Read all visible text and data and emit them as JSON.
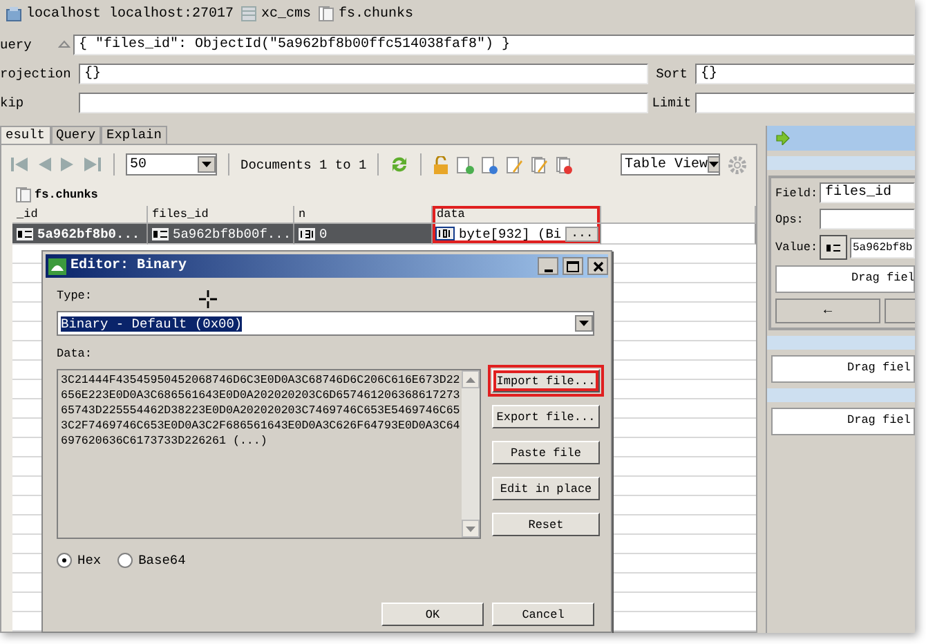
{
  "breadcrumb": [
    {
      "kind": "server",
      "label": "localhost localhost:27017"
    },
    {
      "kind": "database",
      "label": "xc_cms"
    },
    {
      "kind": "collection",
      "label": "fs.chunks"
    }
  ],
  "query": {
    "label": "uery",
    "value": "{ \"files_id\": ObjectId(\"5a962bf8b00ffc514038faf8\") }"
  },
  "projection": {
    "label": "rojection",
    "value": "{}"
  },
  "sort": {
    "label": "Sort",
    "value": "{}"
  },
  "skip": {
    "label": "kip"
  },
  "limit": {
    "label": "Limit"
  },
  "tabs": [
    {
      "label": "esult",
      "selected": true
    },
    {
      "label": "Query",
      "selected": false
    },
    {
      "label": "Explain",
      "selected": false
    }
  ],
  "toolbar": {
    "page_size": "50",
    "documents": "Documents 1 to 1",
    "view": "Table View"
  },
  "collection_title": "fs.chunks",
  "table": {
    "columns": [
      {
        "label": "_id",
        "highlighted": false
      },
      {
        "label": "files_id",
        "highlighted": false
      },
      {
        "label": "n",
        "highlighted": false
      },
      {
        "label": "data",
        "highlighted": true
      }
    ],
    "rows": [
      {
        "selected": true,
        "cells": [
          {
            "kind": "document",
            "text": "5a962bf8b0..."
          },
          {
            "kind": "document",
            "text": "5a962bf8b00f..."
          },
          {
            "kind": "number",
            "text": "0"
          },
          {
            "kind": "binary",
            "text": "byte[932] (Bi",
            "button": "..."
          }
        ]
      }
    ]
  },
  "editor": {
    "title": "Editor: Binary",
    "type_label": "Type:",
    "type_value": "Binary - Default (0x00)",
    "type_text_selected": true,
    "data_label": "Data:",
    "data_lines": [
      "3C21444F43545950452068746D6C3E0D0A3C68746D6C206C616E673D22",
      "656E223E0D0A3C686561643E0D0A202020203C6D657461206368617273",
      "65743D225554462D38223E0D0A202020203C7469746C653E5469746C65",
      "3C2F7469746C653E0D0A3C2F686561643E0D0A3C626F64793E0D0A3C64",
      "697620636C6173733D226261 (...)"
    ],
    "buttons": [
      {
        "label": "Import file...",
        "highlighted": true
      },
      {
        "label": "Export file...",
        "highlighted": false
      },
      {
        "label": "Paste file",
        "highlighted": false
      },
      {
        "label": "Edit in place",
        "highlighted": false
      },
      {
        "label": "Reset",
        "highlighted": false
      }
    ],
    "encodings": [
      {
        "label": "Hex",
        "selected": true
      },
      {
        "label": "Base64",
        "selected": false
      }
    ],
    "ok": "OK",
    "cancel": "Cancel"
  },
  "query_builder": {
    "field_label": "Field:",
    "field_value": "files_id",
    "ops_label": "Ops:",
    "value_label": "Value:",
    "value": "5a962bf8b",
    "drop_zones": [
      "Drag fiel",
      "Drag fiel",
      "Drag fiel"
    ],
    "arrow_button": "←"
  }
}
